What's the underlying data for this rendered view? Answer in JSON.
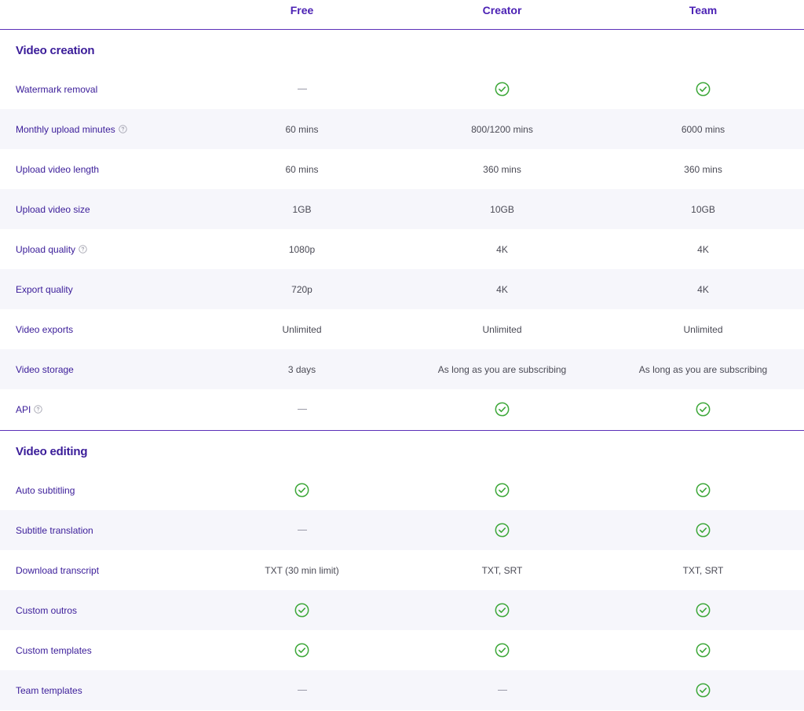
{
  "plans": [
    "Free",
    "Creator",
    "Team"
  ],
  "colors": {
    "accent": "#4b21b4",
    "check": "#3ea83a",
    "dash": "#9a9aa8"
  },
  "sections": [
    {
      "title": "Video creation",
      "rows": [
        {
          "feature": "Watermark removal",
          "help": false,
          "values": [
            {
              "type": "dash"
            },
            {
              "type": "check"
            },
            {
              "type": "check"
            }
          ]
        },
        {
          "feature": "Monthly upload minutes",
          "help": true,
          "values": [
            {
              "type": "text",
              "text": "60 mins"
            },
            {
              "type": "text",
              "text": "800/1200 mins"
            },
            {
              "type": "text",
              "text": "6000 mins"
            }
          ]
        },
        {
          "feature": "Upload video length",
          "help": false,
          "values": [
            {
              "type": "text",
              "text": "60 mins"
            },
            {
              "type": "text",
              "text": "360 mins"
            },
            {
              "type": "text",
              "text": "360 mins"
            }
          ]
        },
        {
          "feature": "Upload video size",
          "help": false,
          "values": [
            {
              "type": "text",
              "text": "1GB"
            },
            {
              "type": "text",
              "text": "10GB"
            },
            {
              "type": "text",
              "text": "10GB"
            }
          ]
        },
        {
          "feature": "Upload quality",
          "help": true,
          "values": [
            {
              "type": "text",
              "text": "1080p"
            },
            {
              "type": "text",
              "text": "4K"
            },
            {
              "type": "text",
              "text": "4K"
            }
          ]
        },
        {
          "feature": "Export quality",
          "help": false,
          "values": [
            {
              "type": "text",
              "text": "720p"
            },
            {
              "type": "text",
              "text": "4K"
            },
            {
              "type": "text",
              "text": "4K"
            }
          ]
        },
        {
          "feature": "Video exports",
          "help": false,
          "values": [
            {
              "type": "text",
              "text": "Unlimited"
            },
            {
              "type": "text",
              "text": "Unlimited"
            },
            {
              "type": "text",
              "text": "Unlimited"
            }
          ]
        },
        {
          "feature": "Video storage",
          "help": false,
          "values": [
            {
              "type": "text",
              "text": "3 days"
            },
            {
              "type": "text",
              "text": "As long as you are subscribing"
            },
            {
              "type": "text",
              "text": "As long as you are subscribing"
            }
          ]
        },
        {
          "feature": "API",
          "help": true,
          "values": [
            {
              "type": "dash"
            },
            {
              "type": "check"
            },
            {
              "type": "check"
            }
          ]
        }
      ]
    },
    {
      "title": "Video editing",
      "rows": [
        {
          "feature": "Auto subtitling",
          "help": false,
          "values": [
            {
              "type": "check"
            },
            {
              "type": "check"
            },
            {
              "type": "check"
            }
          ]
        },
        {
          "feature": "Subtitle translation",
          "help": false,
          "values": [
            {
              "type": "dash"
            },
            {
              "type": "check"
            },
            {
              "type": "check"
            }
          ]
        },
        {
          "feature": "Download transcript",
          "help": false,
          "values": [
            {
              "type": "text",
              "text": "TXT (30 min limit)"
            },
            {
              "type": "text",
              "text": "TXT, SRT"
            },
            {
              "type": "text",
              "text": "TXT, SRT"
            }
          ]
        },
        {
          "feature": "Custom outros",
          "help": false,
          "values": [
            {
              "type": "check"
            },
            {
              "type": "check"
            },
            {
              "type": "check"
            }
          ]
        },
        {
          "feature": "Custom templates",
          "help": false,
          "values": [
            {
              "type": "check"
            },
            {
              "type": "check"
            },
            {
              "type": "check"
            }
          ]
        },
        {
          "feature": "Team templates",
          "help": false,
          "values": [
            {
              "type": "dash"
            },
            {
              "type": "dash"
            },
            {
              "type": "check"
            }
          ]
        }
      ]
    }
  ]
}
